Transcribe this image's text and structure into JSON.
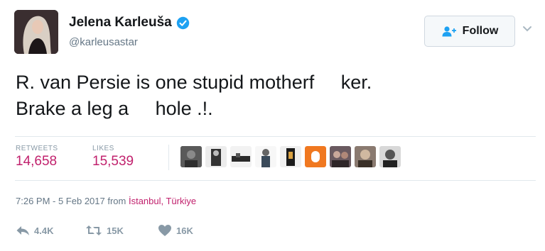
{
  "user": {
    "name": "Jelena Karleuša",
    "handle": "@karleusastar",
    "verified": true
  },
  "follow_button": {
    "label": "Follow",
    "icon": "add-user-icon"
  },
  "tweet": {
    "text": "R. van Persie is one stupid motherf     ker.\nBrake a leg a     hole .!."
  },
  "stats": {
    "retweets_label": "RETWEETS",
    "retweets_value": "14,658",
    "likes_label": "LIKES",
    "likes_value": "15,539"
  },
  "timestamp": {
    "text": "7:26 PM - 5 Feb 2017 from ",
    "location": "İstanbul, Türkiye"
  },
  "actions": {
    "reply_count": "4.4K",
    "retweet_count": "15K",
    "like_count": "16K"
  },
  "colors": {
    "accent": "#c1216d",
    "verified": "#1da1f2",
    "secondary_text": "#657786",
    "action_gray": "#8899a6"
  }
}
